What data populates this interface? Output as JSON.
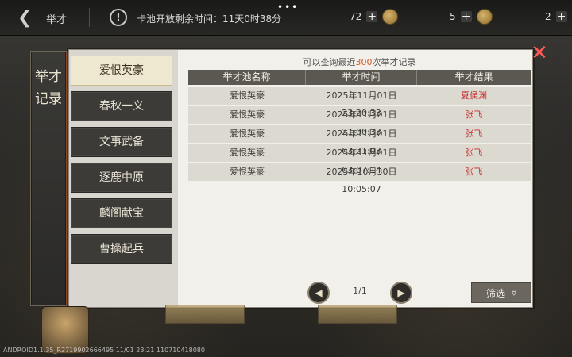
{
  "topbar": {
    "title": "举才",
    "countdown": "卡池开放剩余时间：11天0时38分",
    "resources": [
      {
        "amount": "72"
      },
      {
        "amount": "5"
      },
      {
        "amount": "2"
      }
    ]
  },
  "sidebar": {
    "tab_label": "举才记录",
    "items": [
      {
        "label": "爱恨英豪",
        "active": true
      },
      {
        "label": "春秋一义",
        "active": false
      },
      {
        "label": "文事武备",
        "active": false
      },
      {
        "label": "逐鹿中原",
        "active": false
      },
      {
        "label": "麟阁献宝",
        "active": false
      },
      {
        "label": "曹操起兵",
        "active": false
      }
    ]
  },
  "caption": {
    "prefix": "可以查询最近",
    "highlight": "300",
    "suffix": "次举才记录"
  },
  "table": {
    "headers": [
      "举才池名称",
      "举才时间",
      "举才结果"
    ],
    "rows": [
      [
        "爱恨英豪",
        "2025年11月01日 23:20:33",
        "夏侯渊"
      ],
      [
        "爱恨英豪",
        "2025年11月01日 21:00:33",
        "张飞"
      ],
      [
        "爱恨英豪",
        "2025年11月01日 03:21:03",
        "张飞"
      ],
      [
        "爱恨英豪",
        "2025年11月01日 03:07:14",
        "张飞"
      ],
      [
        "爱恨英豪",
        "2025年10月30日 10:05:07",
        "张飞"
      ]
    ]
  },
  "pager": {
    "text": "1/1"
  },
  "filter": {
    "label": "筛选"
  },
  "watermark": "ANDROID1.1.35_R2719902666495 11/01 23:21 110710418080"
}
